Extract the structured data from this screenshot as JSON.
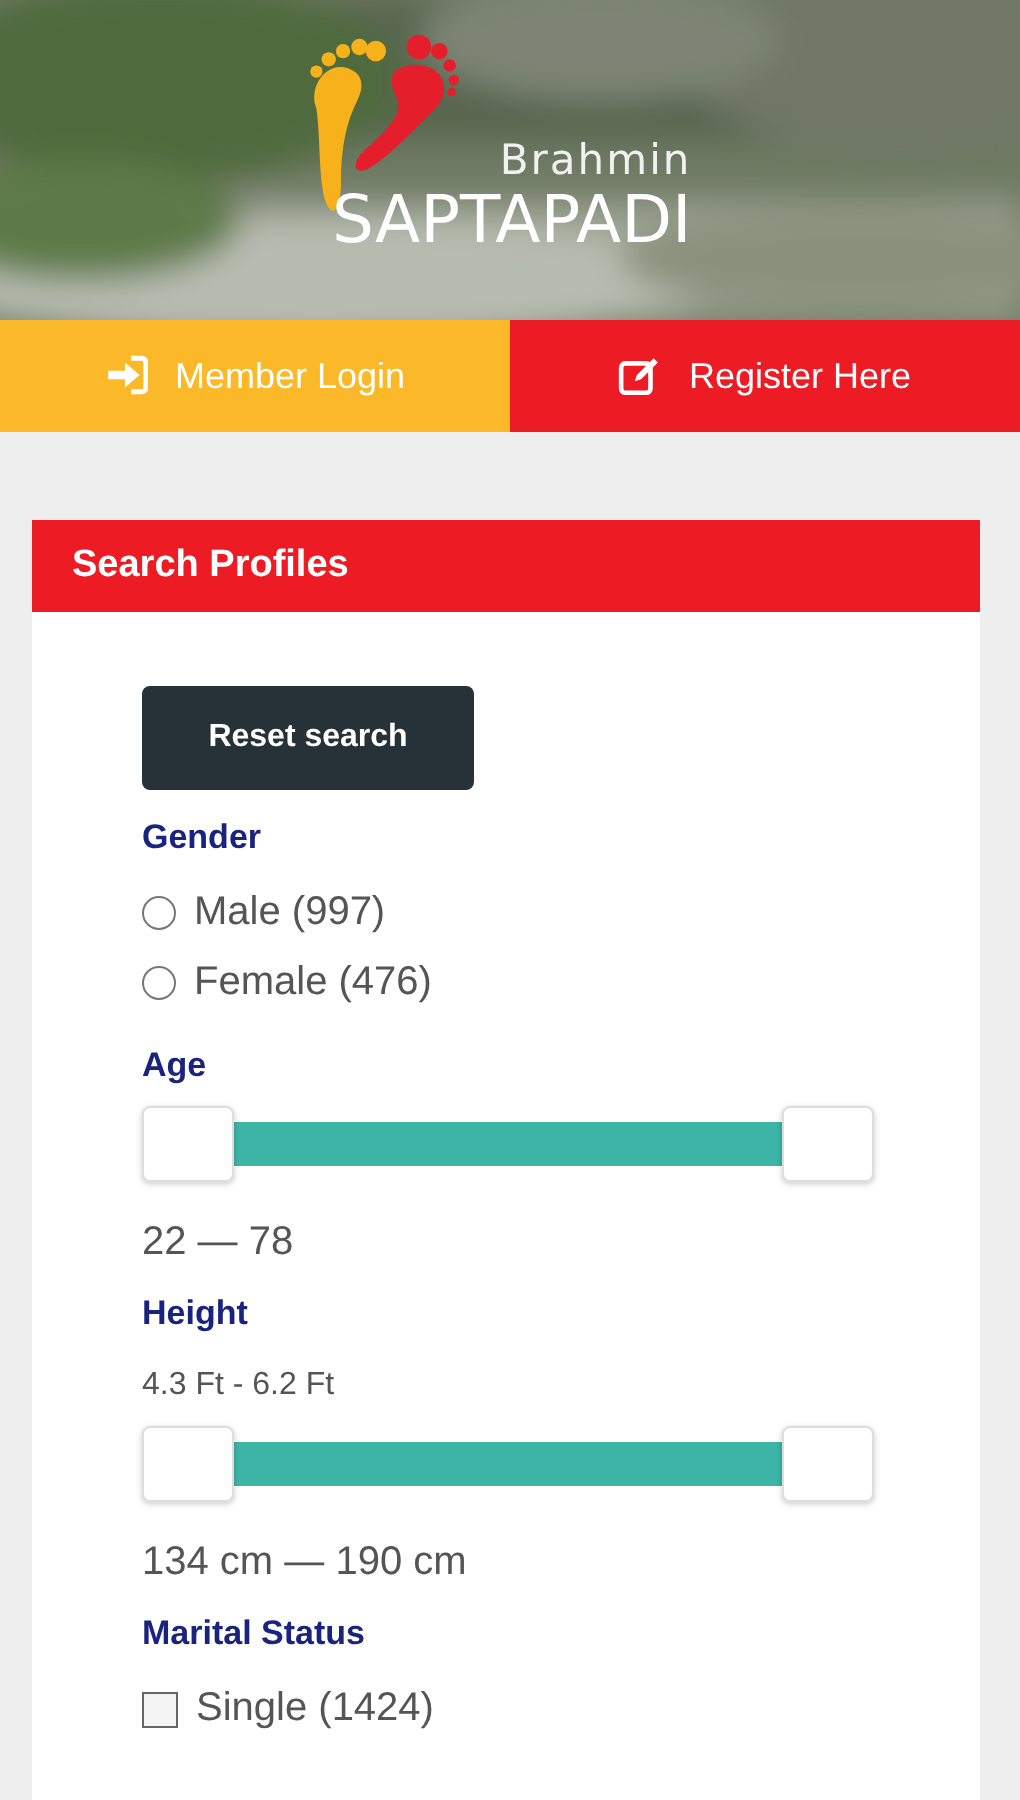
{
  "header": {
    "kind": "picture",
    "logo": {
      "line_1": "Brahmin",
      "line_2": "SAPTAPADI"
    }
  },
  "nav_buttons": [
    {
      "label": "Member Login",
      "kind": "login",
      "color": "#fbb829"
    },
    {
      "label": "Register Here",
      "kind": "register",
      "color": "#ed1c24"
    }
  ],
  "panel": {
    "title": "Search Profiles",
    "reset_button": "Reset search",
    "filters": [
      {
        "kind": "radio",
        "label": "Gender",
        "options": [
          {
            "label": "Male (997)",
            "selected": false
          },
          {
            "label": "Female (476)",
            "selected": false
          }
        ]
      },
      {
        "kind": "range",
        "label": "Age",
        "handles": [
          {
            "level": 0
          },
          {
            "level": 1
          }
        ],
        "reading": "22 — 78"
      },
      {
        "kind": "range",
        "label": "Height",
        "subtitle": "4.3 Ft - 6.2 Ft",
        "handles": [
          {
            "level": 0
          },
          {
            "level": 1
          }
        ],
        "reading": "134 cm — 190 cm"
      },
      {
        "kind": "checkbox",
        "label": "Marital Status",
        "options": [
          {
            "label": "Single (1424)",
            "checked": false
          }
        ]
      }
    ]
  }
}
